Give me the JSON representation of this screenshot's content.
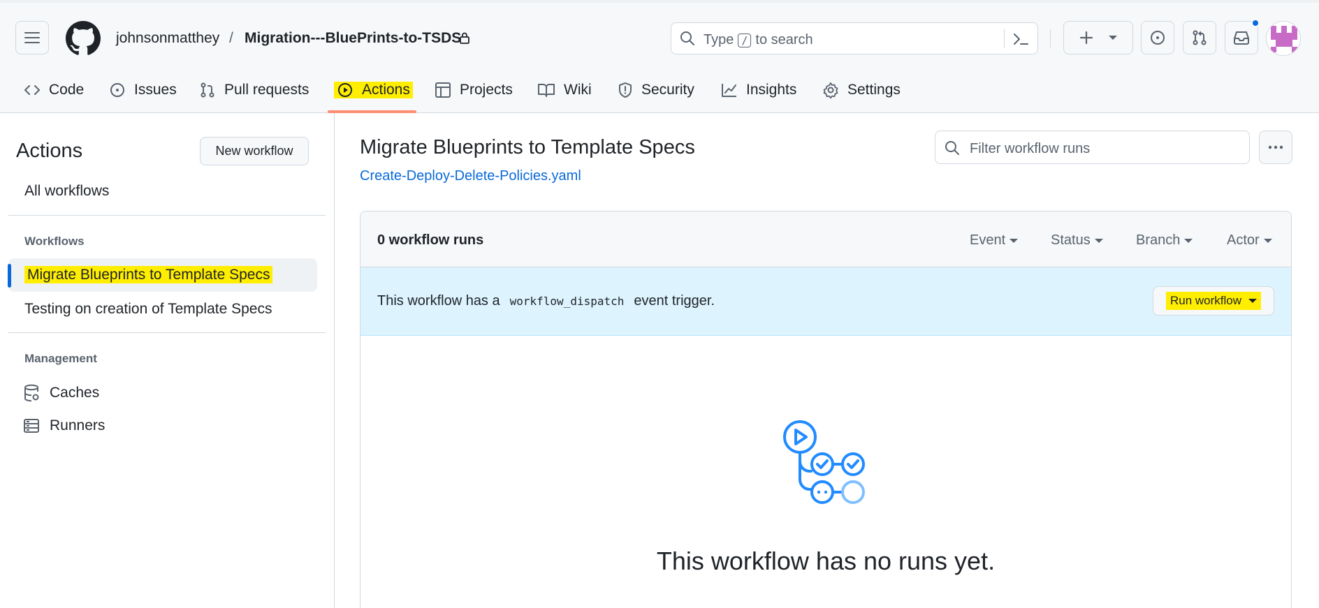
{
  "repo": {
    "owner": "johnsonmatthey",
    "separator": "/",
    "name": "Migration---BluePrints-to-TSDS"
  },
  "search": {
    "prefix": "Type",
    "kbd": "/",
    "suffix": "to search"
  },
  "nav": {
    "code": "Code",
    "issues": "Issues",
    "pull_requests": "Pull requests",
    "actions": "Actions",
    "projects": "Projects",
    "wiki": "Wiki",
    "security": "Security",
    "insights": "Insights",
    "settings": "Settings"
  },
  "sidebar": {
    "title": "Actions",
    "new_workflow": "New workflow",
    "all_workflows": "All workflows",
    "workflows_heading": "Workflows",
    "workflows": [
      "Migrate Blueprints to Template Specs",
      "Testing on creation of Template Specs"
    ],
    "management_heading": "Management",
    "caches": "Caches",
    "runners": "Runners"
  },
  "main": {
    "title": "Migrate Blueprints to Template Specs",
    "file": "Create-Deploy-Delete-Policies.yaml",
    "filter_placeholder": "Filter workflow runs",
    "run_count": "0 workflow runs",
    "filters": [
      "Event",
      "Status",
      "Branch",
      "Actor"
    ],
    "dispatch_prefix": "This workflow has a",
    "dispatch_code": "workflow_dispatch",
    "dispatch_suffix": "event trigger.",
    "run_workflow": "Run workflow",
    "empty_message": "This workflow has no runs yet."
  },
  "colors": {
    "highlight": "#ffee00",
    "link": "#0969da",
    "nav_underline": "#fd8c73",
    "dispatch_bg": "#ddf4ff",
    "illustration": "#218bff"
  },
  "icons": [
    "hamburger-icon",
    "github-logo-icon",
    "lock-icon",
    "search-icon",
    "terminal-icon",
    "plus-icon",
    "issue-icon",
    "pull-request-icon",
    "inbox-icon",
    "code-icon",
    "play-icon",
    "table-icon",
    "book-icon",
    "shield-icon",
    "graph-icon",
    "gear-icon",
    "database-icon",
    "server-icon",
    "kebab-icon",
    "workflow-illustration-icon"
  ]
}
